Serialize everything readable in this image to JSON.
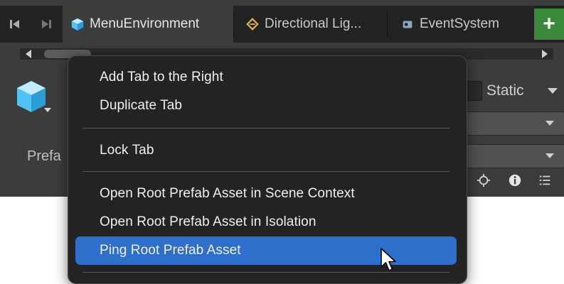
{
  "tabbar": {
    "tabs": [
      {
        "label": "MenuEnvironment",
        "icon": "cube-icon",
        "active": true
      },
      {
        "label": "Directional Lig...",
        "icon": "directional-light-icon",
        "active": false
      },
      {
        "label": "EventSystem",
        "icon": "script-icon",
        "active": false
      }
    ],
    "add_tab_label": "+"
  },
  "inspector": {
    "static_label": "Static",
    "prefab_label": "Prefa"
  },
  "context_menu": {
    "items": [
      {
        "label": "Add Tab to the Right"
      },
      {
        "label": "Duplicate Tab"
      },
      {
        "label": "Lock Tab"
      },
      {
        "label": "Open Root Prefab Asset in Scene Context"
      },
      {
        "label": "Open Root Prefab Asset in Isolation"
      },
      {
        "label": "Ping Root Prefab Asset",
        "highlighted": true
      }
    ]
  },
  "colors": {
    "menu_highlight": "#2f6fcc",
    "add_button": "#3b8a3b",
    "prefab_cube": "#4fc3f7"
  }
}
